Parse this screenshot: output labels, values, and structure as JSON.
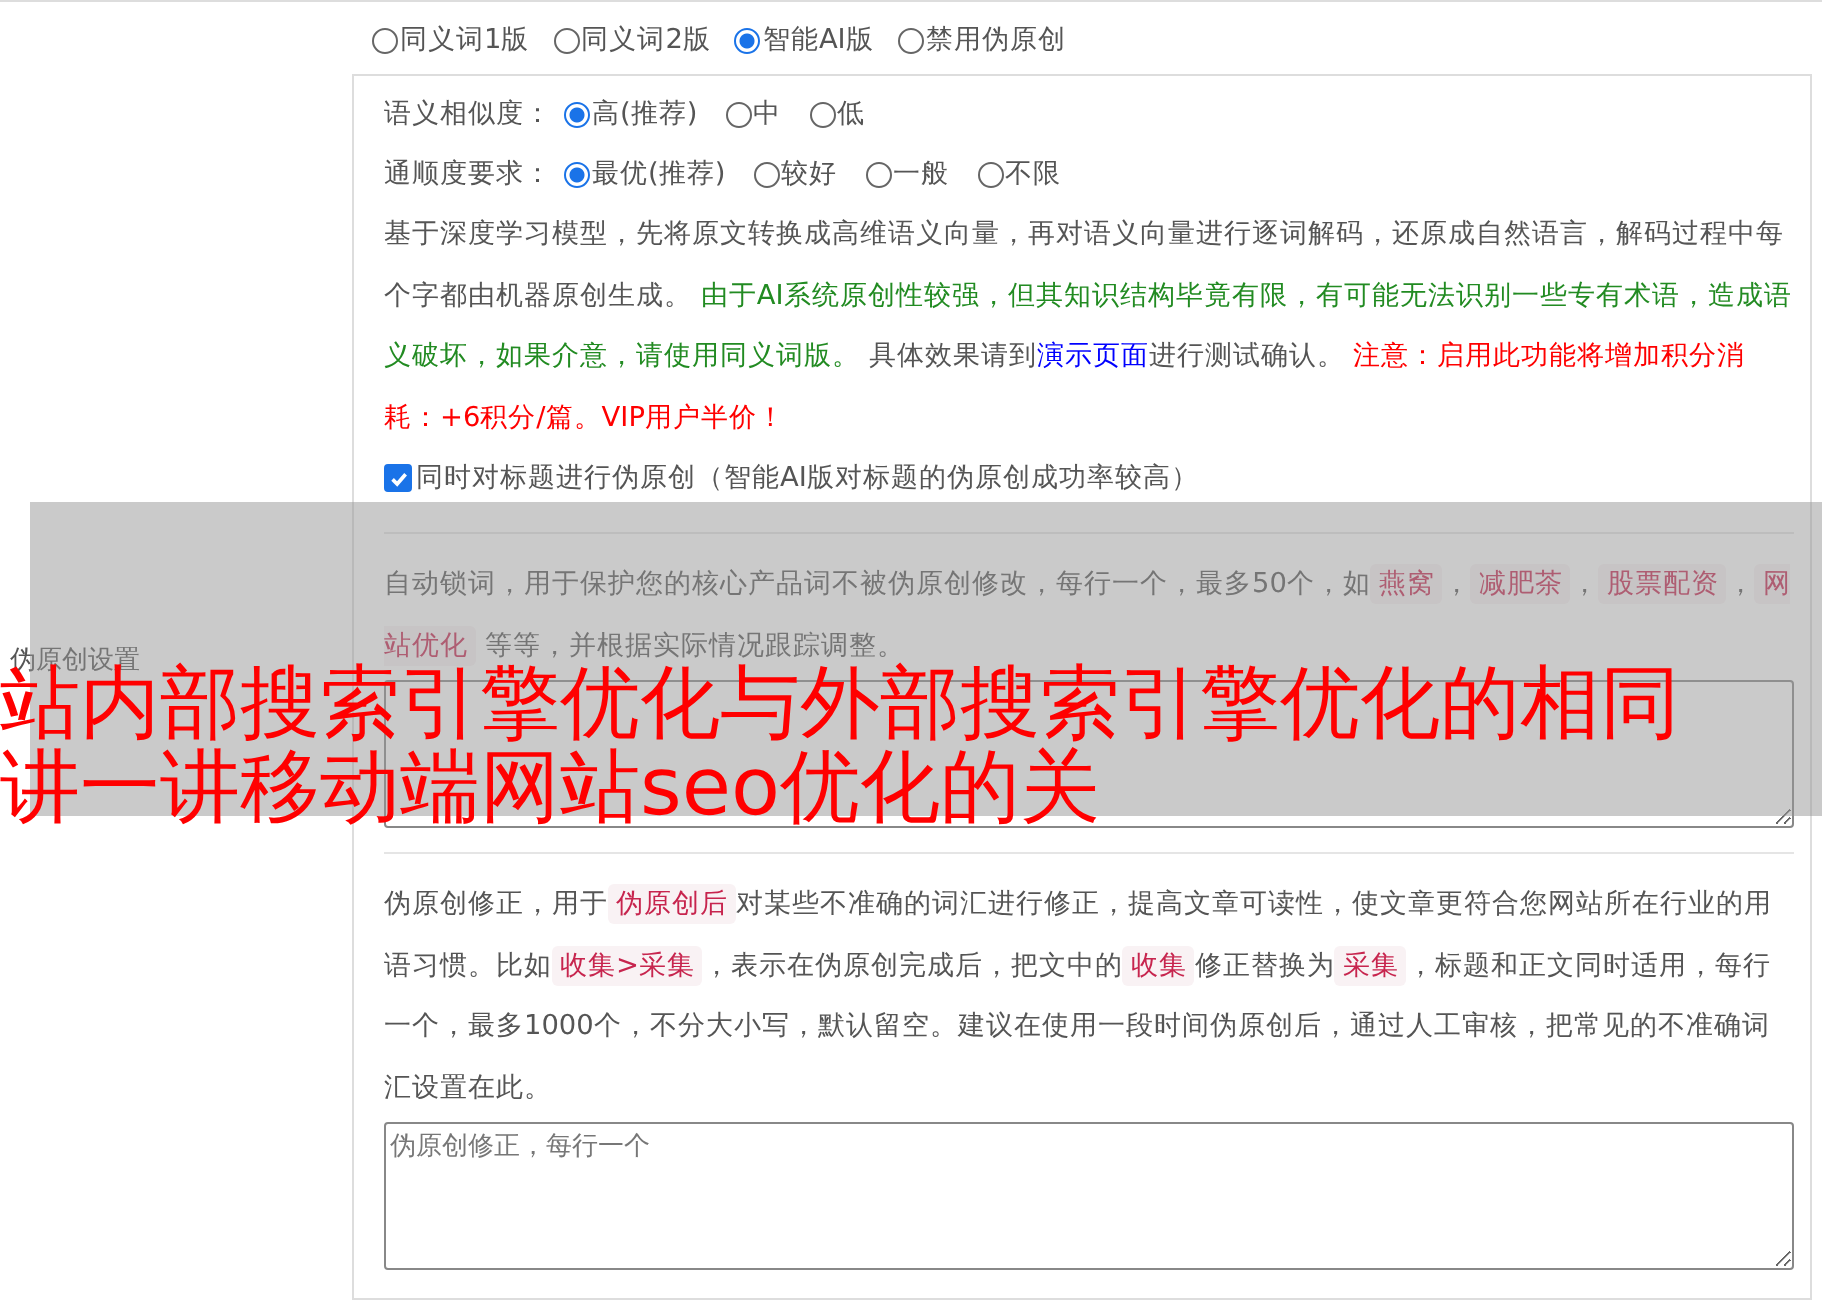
{
  "mode_options": [
    {
      "label": "同义词1版",
      "selected": false
    },
    {
      "label": "同义词2版",
      "selected": false
    },
    {
      "label": "智能AI版",
      "selected": true
    },
    {
      "label": "禁用伪原创",
      "selected": false
    }
  ],
  "settings": {
    "similarity": {
      "label": "语义相似度：",
      "options": [
        {
          "label": "高(推荐)",
          "selected": true
        },
        {
          "label": "中",
          "selected": false
        },
        {
          "label": "低",
          "selected": false
        }
      ]
    },
    "fluency": {
      "label": "通顺度要求：",
      "options": [
        {
          "label": "最优(推荐)",
          "selected": true
        },
        {
          "label": "较好",
          "selected": false
        },
        {
          "label": "一般",
          "selected": false
        },
        {
          "label": "不限",
          "selected": false
        }
      ]
    },
    "description": [
      {
        "kind": "plain",
        "text": "基于深度学习模型，先将原文转换成高维语义向量，再对语义向量进行逐词解码，还原成自然语言，解码过程中每个字都由机器原创生成。"
      },
      {
        "kind": "green",
        "text": " 由于AI系统原创性较强，但其知识结构毕竟有限，有可能无法识别一些专有术语，造成语义破坏，如果介意，请使用同义词版。"
      },
      {
        "kind": "plain",
        "text": " 具体效果请到"
      },
      {
        "kind": "link",
        "text": "演示页面"
      },
      {
        "kind": "plain",
        "text": "进行测试确认。"
      },
      {
        "kind": "red",
        "text": " 注意：启用此功能将增加积分消耗：+6积分/篇。VIP用户半价！"
      }
    ],
    "title_checkbox": {
      "label": "同时对标题进行伪原创（智能AI版对标题的伪原创成功率较高）",
      "checked": true
    }
  },
  "section_label": "伪原创设置",
  "lock_words": {
    "description": [
      {
        "kind": "plain",
        "text": "自动锁词，用于保护您的核心产品词不被伪原创修改，每行一个，最多50个，如"
      },
      {
        "kind": "tag",
        "text": "燕窝"
      },
      {
        "kind": "plain",
        "text": "，"
      },
      {
        "kind": "tag",
        "text": "减肥茶"
      },
      {
        "kind": "plain",
        "text": "，"
      },
      {
        "kind": "tag",
        "text": "股票配资"
      },
      {
        "kind": "plain",
        "text": "，"
      },
      {
        "kind": "tag",
        "text": "网站优化"
      },
      {
        "kind": "plain",
        "text": " 等等，并根据实际情况跟踪调整。"
      }
    ]
  },
  "correction": {
    "description": [
      {
        "kind": "plain",
        "text": "伪原创修正，用于"
      },
      {
        "kind": "tag",
        "text": "伪原创后"
      },
      {
        "kind": "plain",
        "text": "对某些不准确的词汇进行修正，提高文章可读性，使文章更符合您网站所在行业的用语习惯。比如"
      },
      {
        "kind": "tag",
        "text": "收集>采集"
      },
      {
        "kind": "plain",
        "text": "，表示在伪原创完成后，把文中的"
      },
      {
        "kind": "tag",
        "text": "收集"
      },
      {
        "kind": "plain",
        "text": "修正替换为"
      },
      {
        "kind": "tag",
        "text": "采集"
      },
      {
        "kind": "plain",
        "text": "，标题和正文同时适用，每行一个，最多1000个，不分大小写，默认留空。建议在使用一段时间伪原创后，通过人工审核，把常见的不准确词汇设置在此。"
      }
    ],
    "placeholder": "伪原创修正，每行一个"
  },
  "overlay": {
    "lines": [
      "站内部搜索引擎优化与外部搜索引擎优化的相同",
      "讲一讲移动端网站seo优化的关"
    ]
  }
}
